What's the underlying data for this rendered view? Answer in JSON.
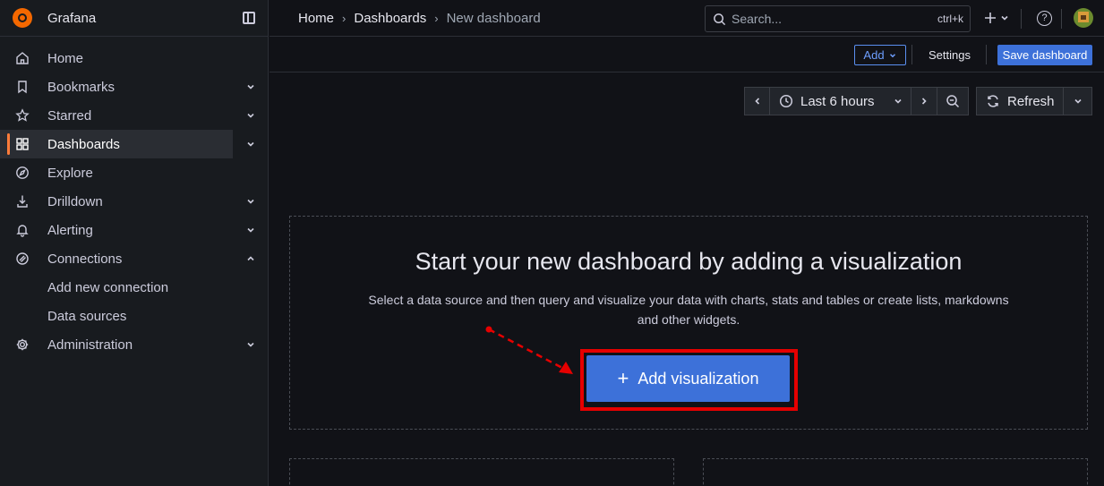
{
  "app": {
    "name": "Grafana"
  },
  "sidebar": {
    "items": [
      {
        "label": "Home",
        "icon": "home-icon",
        "chevron": ""
      },
      {
        "label": "Bookmarks",
        "icon": "bookmark-icon",
        "chevron": "down"
      },
      {
        "label": "Starred",
        "icon": "star-icon",
        "chevron": "down"
      },
      {
        "label": "Dashboards",
        "icon": "dashboards-grid-icon",
        "chevron": "down",
        "active": true
      },
      {
        "label": "Explore",
        "icon": "compass-icon",
        "chevron": ""
      },
      {
        "label": "Drilldown",
        "icon": "drilldown-icon",
        "chevron": "down"
      },
      {
        "label": "Alerting",
        "icon": "bell-icon",
        "chevron": "down"
      },
      {
        "label": "Connections",
        "icon": "connections-icon",
        "chevron": "up"
      },
      {
        "label": "Add new connection",
        "sub": true
      },
      {
        "label": "Data sources",
        "sub": true
      },
      {
        "label": "Administration",
        "icon": "gear-icon",
        "chevron": "down"
      }
    ]
  },
  "breadcrumb": [
    "Home",
    "Dashboards",
    "New dashboard"
  ],
  "search": {
    "placeholder": "Search...",
    "shortcut": "ctrl+k"
  },
  "toolbar": {
    "add_label": "Add",
    "settings_label": "Settings",
    "save_label": "Save dashboard"
  },
  "time": {
    "range_label": "Last 6 hours",
    "refresh_label": "Refresh"
  },
  "empty_state": {
    "title": "Start your new dashboard by adding a visualization",
    "description": "Select a data source and then query and visualize your data with charts, stats and tables or create lists, markdowns and other widgets.",
    "button_label": "Add visualization"
  },
  "colors": {
    "accent": "#3d71d9",
    "highlight": "#e60000",
    "active_bar": "#ff7c3a",
    "brand": "#f46800"
  }
}
